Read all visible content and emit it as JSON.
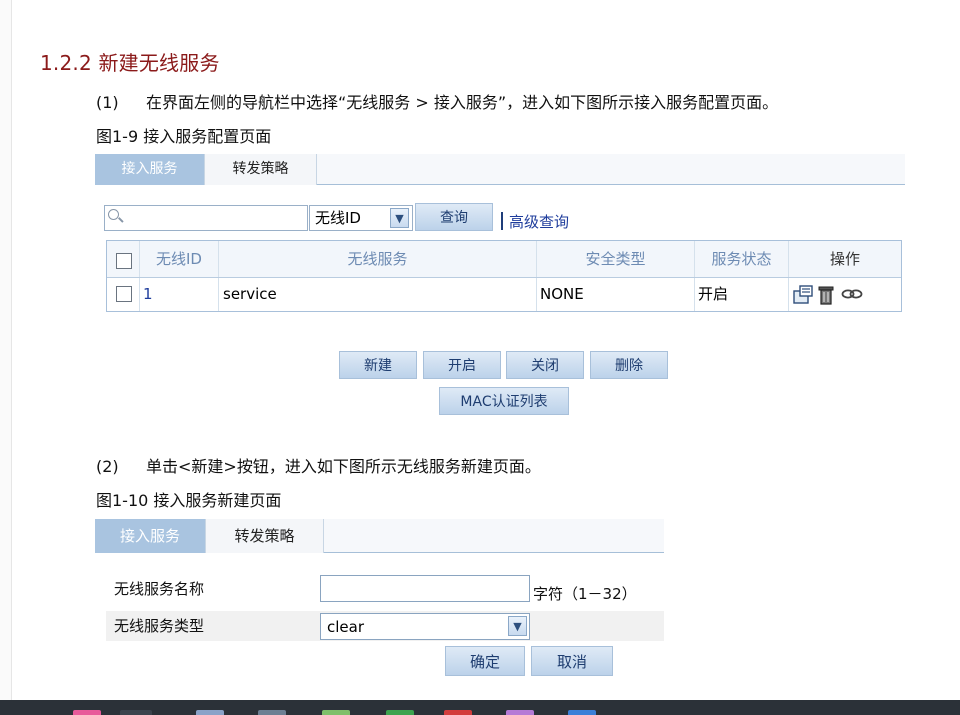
{
  "heading": "1.2.2  新建无线服务",
  "step1": {
    "num": "(1)",
    "text": "在界面左侧的导航栏中选择“无线服务 > 接入服务”，进入如下图所示接入服务配置页面。"
  },
  "caption1": "图1-9 接入服务配置页面",
  "tabs": {
    "access": "接入服务",
    "forward": "转发策略"
  },
  "search": {
    "placeholder": "",
    "field_select": "无线ID",
    "query_button": "查询",
    "advanced_link": "高级查询"
  },
  "table": {
    "headers": [
      "无线ID",
      "无线服务",
      "安全类型",
      "服务状态",
      "操作"
    ],
    "rows": [
      {
        "id": "1",
        "service": "service",
        "security": "NONE",
        "status": "开启"
      }
    ],
    "op_icons": [
      "detail-icon",
      "delete-icon",
      "link-icon"
    ]
  },
  "actions": {
    "new": "新建",
    "enable": "开启",
    "disable": "关闭",
    "delete": "删除",
    "mac_list": "MAC认证列表"
  },
  "step2": {
    "num": "(2)",
    "text": "单击<新建>按钮，进入如下图所示无线服务新建页面。"
  },
  "caption2": "图1-10 接入服务新建页面",
  "form": {
    "name_label": "无线服务名称",
    "name_value": "",
    "name_hint": "字符（1－32）",
    "type_label": "无线服务类型",
    "type_value": "clear",
    "ok": "确定",
    "cancel": "取消"
  },
  "colors": {
    "heading": "#8b1a1a",
    "tab_active": "#a9c4e0",
    "link": "#1f3d9c",
    "header_text": "#6d8bb3"
  }
}
